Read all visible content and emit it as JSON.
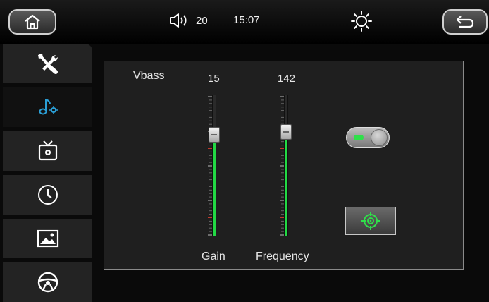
{
  "topbar": {
    "volume": "20",
    "time": "15:07",
    "icons": [
      "home-icon",
      "volume-icon",
      "brightness-icon",
      "back-icon"
    ]
  },
  "sidebar": {
    "items": [
      {
        "icon": "tools-icon"
      },
      {
        "icon": "audio-settings-icon",
        "active": true
      },
      {
        "icon": "tv-settings-icon"
      },
      {
        "icon": "clock-icon"
      },
      {
        "icon": "image-icon"
      },
      {
        "icon": "steering-wheel-icon"
      }
    ]
  },
  "panel": {
    "title": "Vbass",
    "gain": {
      "label": "Gain",
      "value": "15",
      "level": 0.72
    },
    "frequency": {
      "label": "Frequency",
      "value": "142",
      "level": 0.74
    },
    "toggle_on": true
  },
  "colors": {
    "accent": "#22d944",
    "active_icon": "#2b9fd6"
  }
}
